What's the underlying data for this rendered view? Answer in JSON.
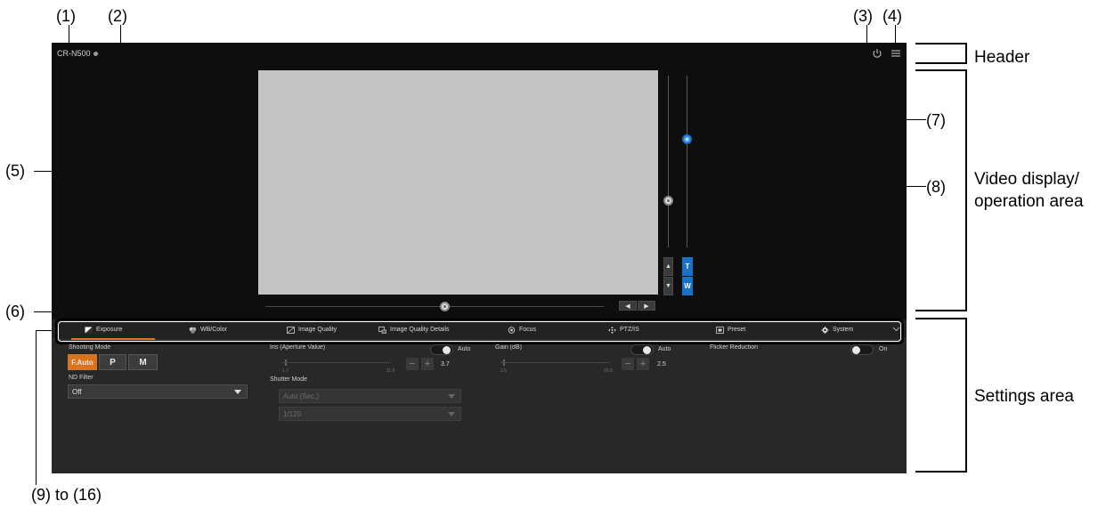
{
  "callouts": {
    "c1": "(1)",
    "c2": "(2)",
    "c3": "(3)",
    "c4": "(4)",
    "c5": "(5)",
    "c6": "(6)",
    "c7": "(7)",
    "c8": "(8)",
    "c9": "(9) to (16)"
  },
  "areas": {
    "header": "Header",
    "video_line1": "Video display/",
    "video_line2": "operation area",
    "settings": "Settings area"
  },
  "header": {
    "model": "CR-N500"
  },
  "zoom": {
    "tele": "T",
    "wide": "W"
  },
  "tabs": [
    {
      "label": "Exposure",
      "icon": "exposure-icon"
    },
    {
      "label": "WB/Color",
      "icon": "color-icon"
    },
    {
      "label": "Image Quality",
      "icon": "image-quality-icon"
    },
    {
      "label": "Image Quality Details",
      "icon": "image-quality-details-icon"
    },
    {
      "label": "Focus",
      "icon": "focus-icon"
    },
    {
      "label": "PTZ/IS",
      "icon": "ptz-icon"
    },
    {
      "label": "Preset",
      "icon": "preset-icon"
    },
    {
      "label": "System",
      "icon": "gear-icon"
    }
  ],
  "exposure": {
    "shooting_mode_label": "Shooting Mode",
    "modes": [
      "F.Auto",
      "P",
      "M"
    ],
    "active_mode": "F.Auto",
    "nd_label": "ND Filter",
    "nd_value": "Off",
    "iris_label": "Iris (Aperture Value)",
    "iris_auto_label": "Auto",
    "iris_min": "1.7",
    "iris_max": "11.0",
    "iris_value": "3.7",
    "shutter_mode_label": "Shutter Mode",
    "shutter_mode_value": "Auto (Sec.)",
    "shutter_speed_value": "1/120",
    "gain_label": "Gain (dB)",
    "gain_auto_label": "Auto",
    "gain_min": "2.5",
    "gain_max": "33.0",
    "gain_value": "2.5",
    "flicker_label": "Flicker Reduction",
    "flicker_state": "On"
  },
  "colors": {
    "accent": "#d9731c",
    "zoom_blue": "#1773c7",
    "knob_blue": "#4aa3ff"
  }
}
